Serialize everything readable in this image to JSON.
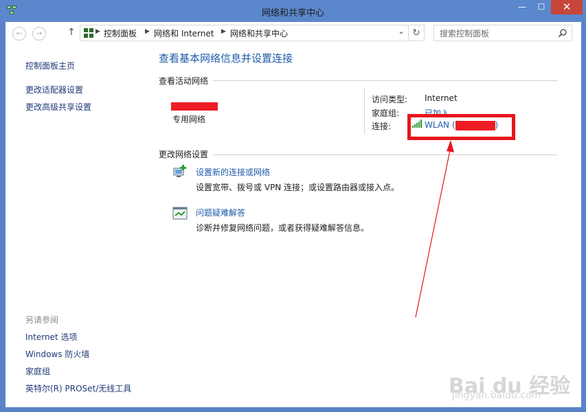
{
  "window": {
    "title": "网络和共享中心",
    "min_label": "—",
    "max_label": "☐",
    "close_label": "✕"
  },
  "nav": {
    "back_label": "←",
    "forward_label": "→",
    "up_label": "↑",
    "breadcrumb": [
      "控制面板",
      "网络和 Internet",
      "网络和共享中心"
    ],
    "dropdown_label": "⌄",
    "refresh_label": "↻",
    "search_placeholder": "搜索控制面板"
  },
  "sidebar": {
    "home": "控制面板主页",
    "items": [
      "更改适配器设置",
      "更改高级共享设置"
    ],
    "see_also_heading": "另请参阅",
    "see_also": [
      "Internet 选项",
      "Windows 防火墙",
      "家庭组",
      "英特尔(R) PROSet/无线工具"
    ]
  },
  "main": {
    "title": "查看基本网络信息并设置连接",
    "active_networks_heading": "查看活动网络",
    "network_type": "专用网络",
    "access_type_label": "访问类型:",
    "access_type_value": "Internet",
    "homegroup_label": "家庭组:",
    "homegroup_value": "已加入",
    "connections_label": "连接:",
    "connection_value": "WLAN (",
    "connection_close": ")",
    "change_settings_heading": "更改网络设置",
    "tasks": [
      {
        "title": "设置新的连接或网络",
        "desc": "设置宽带、拨号或 VPN 连接；或设置路由器或接入点。"
      },
      {
        "title": "问题疑难解答",
        "desc": "诊断并修复网络问题，或者获得疑难解答信息。"
      }
    ]
  },
  "watermark": {
    "text": "Bai du 经验",
    "sub": "jingyan.baidu.com"
  },
  "colors": {
    "title_bar": "#5b87cc",
    "link": "#1e5aa8",
    "annotation_red": "#e8141c"
  }
}
